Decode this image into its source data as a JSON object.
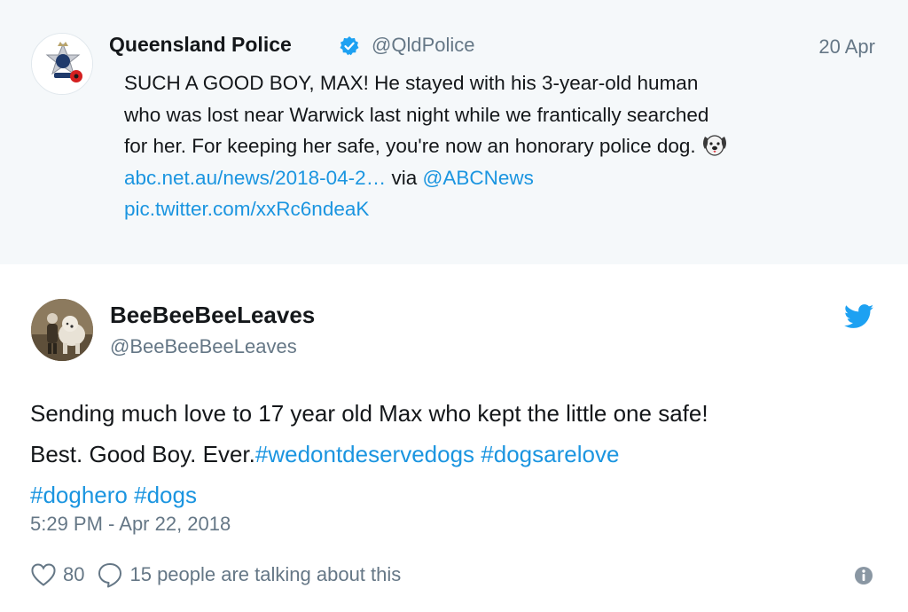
{
  "quoted_tweet": {
    "author_name": "Queensland Police",
    "author_handle": "@QldPolice",
    "date": "20 Apr",
    "verified_icon": "verified-badge-icon",
    "text_lines": [
      "SUCH A GOOD BOY, MAX! He stayed with his 3-year-old human",
      "who was lost near Warwick last night while we frantically searched",
      "for her. For keeping her safe, you're now an honorary police dog."
    ],
    "link_url": "abc.net.au/news/2018-04-2…",
    "via_text": "via",
    "via_handle": "@ABCNews",
    "pic_link": "pic.twitter.com/xxRc6ndeaK"
  },
  "tweet": {
    "author_name": "BeeBeeBeeLeaves",
    "author_handle": "@BeeBeeBeeLeaves",
    "text_line1": "Sending much love to 17 year old Max who kept the little one safe!",
    "text_line2_plain": "Best. Good Boy. Ever.",
    "hashtags_line2": [
      "#wedontdeservedogs",
      "#dogsarelove"
    ],
    "hashtags_line3": [
      "#doghero",
      "#dogs"
    ],
    "timestamp": "5:29 PM - Apr 22, 2018",
    "like_count": "80",
    "conversation_text": "15 people are talking about this"
  },
  "colors": {
    "link": "#1b95e0",
    "secondary_text": "#657786",
    "quoted_background": "#f5f8fa",
    "twitter_blue": "#1da1f2"
  }
}
